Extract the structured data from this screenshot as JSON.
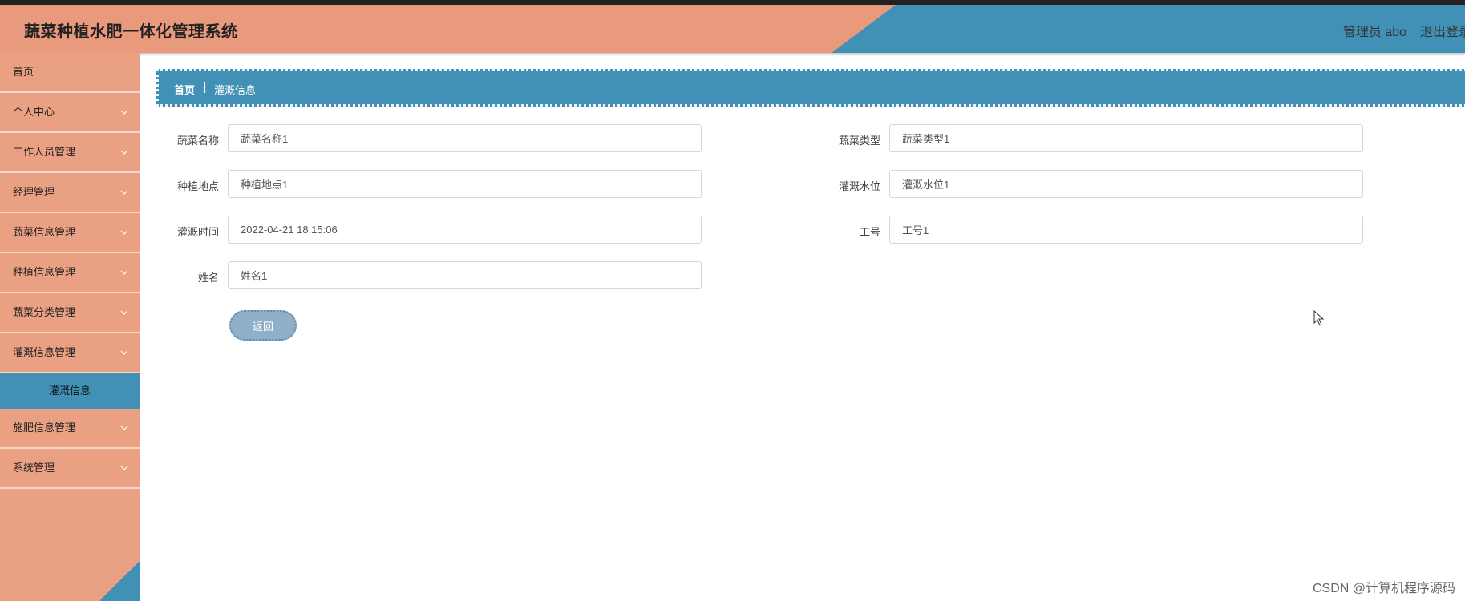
{
  "header": {
    "title": "蔬菜种植水肥一体化管理系统",
    "user": "管理员 abo",
    "logout": "退出登录"
  },
  "sidebar": {
    "items": [
      {
        "label": "首页",
        "has_arrow": false
      },
      {
        "label": "个人中心",
        "has_arrow": true
      },
      {
        "label": "工作人员管理",
        "has_arrow": true
      },
      {
        "label": "经理管理",
        "has_arrow": true
      },
      {
        "label": "蔬菜信息管理",
        "has_arrow": true
      },
      {
        "label": "种植信息管理",
        "has_arrow": true
      },
      {
        "label": "蔬菜分类管理",
        "has_arrow": true
      },
      {
        "label": "灌溉信息管理",
        "has_arrow": true
      },
      {
        "label": "施肥信息管理",
        "has_arrow": true
      },
      {
        "label": "系统管理",
        "has_arrow": true
      }
    ],
    "active_sub": "灌溉信息"
  },
  "breadcrumb": {
    "home": "首页",
    "separator": "|",
    "current": "灌溉信息"
  },
  "form": {
    "fields": [
      {
        "label": "蔬菜名称",
        "value": "蔬菜名称1"
      },
      {
        "label": "蔬菜类型",
        "value": "蔬菜类型1"
      },
      {
        "label": "种植地点",
        "value": "种植地点1"
      },
      {
        "label": "灌溉水位",
        "value": "灌溉水位1"
      },
      {
        "label": "灌溉时间",
        "value": "2022-04-21 18:15:06"
      },
      {
        "label": "工号",
        "value": "工号1"
      },
      {
        "label": "姓名",
        "value": "姓名1"
      }
    ],
    "back_label": "返回"
  },
  "watermark": "CSDN @计算机程序源码",
  "colors": {
    "accent_orange": "#e9997c",
    "accent_blue": "#4190b6",
    "button": "#8fb0c8"
  }
}
